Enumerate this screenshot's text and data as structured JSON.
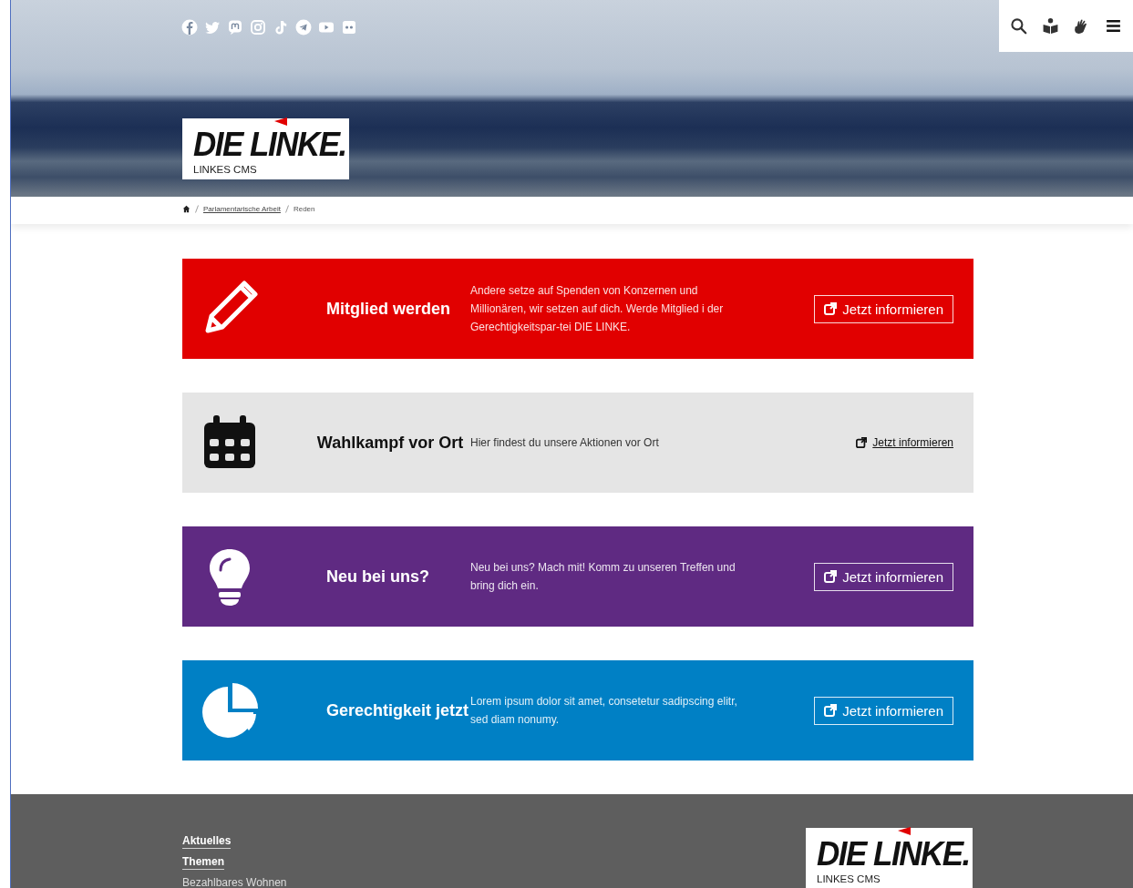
{
  "logo": {
    "wordmark": "DIE LINKE.",
    "subtitle": "LINKES CMS"
  },
  "breadcrumb": [
    {
      "label": "Parlamentarische Arbeit",
      "kind": "link"
    },
    {
      "label": "Reden",
      "kind": "current"
    }
  ],
  "banners": [
    {
      "kind": "dark",
      "color": "#e10000",
      "title": "Mitglied werden",
      "text": "Andere setze auf Spenden von Konzernen und Millionären, wir setzen auf dich. Werde Mitglied i der Gerechtigkeitspar-tei DIE LINKE.",
      "cta": "Jetzt informieren"
    },
    {
      "kind": "light",
      "color": "#e5e5e5",
      "title": "Wahlkampf vor Ort",
      "text": "Hier findest du unsere Aktionen vor Ort",
      "cta": "Jetzt informieren"
    },
    {
      "kind": "dark",
      "color": "#5f2a82",
      "title": "Neu bei uns?",
      "text": "Neu bei uns? Mach mit! Komm zu unseren Treffen und bring dich ein.",
      "cta": "Jetzt informieren"
    },
    {
      "kind": "dark",
      "color": "#0080c5",
      "title": "Gerechtigkeit jetzt",
      "text": "Lorem ipsum dolor sit amet, consetetur sadipscing elitr, sed diam nonumy.",
      "cta": "Jetzt informieren"
    }
  ],
  "footer": {
    "links": [
      {
        "label": "Aktuelles",
        "kind": "section"
      },
      {
        "label": "Themen",
        "kind": "section"
      },
      {
        "label": "Bezahlbares Wohnen",
        "kind": "page"
      }
    ],
    "logo": {
      "wordmark": "DIE LINKE.",
      "subtitle": "LINKES CMS"
    }
  }
}
